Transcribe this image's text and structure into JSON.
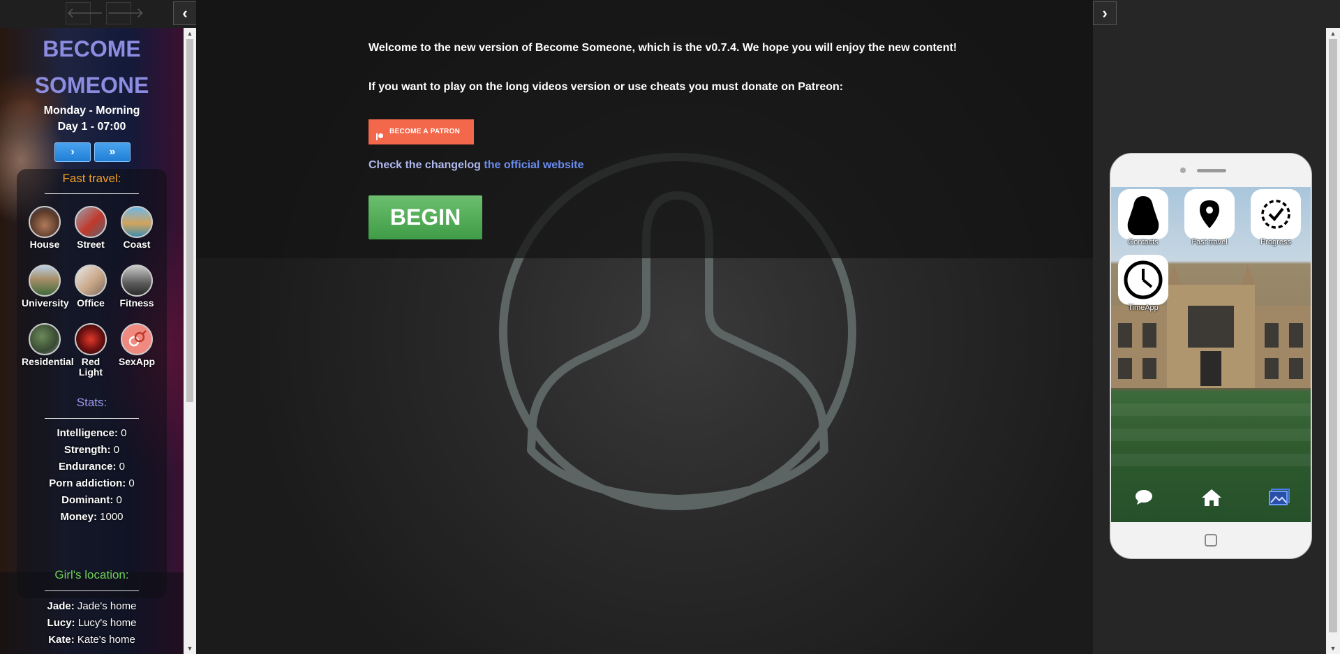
{
  "left_sidebar": {
    "title_line1": "BECOME",
    "title_line2": "SOMEONE",
    "day_time": "Monday - Morning",
    "day_clock": "Day 1 - 07:00",
    "time_buttons": [
      "›",
      "»"
    ],
    "fast_travel_title": "Fast travel:",
    "locations": [
      "House",
      "Street",
      "Coast",
      "University",
      "Office",
      "Fitness",
      "Residential",
      "Red Light",
      "SexApp"
    ],
    "stats_title": "Stats:",
    "stats": [
      {
        "label": "Intelligence:",
        "value": "0"
      },
      {
        "label": "Strength:",
        "value": "0"
      },
      {
        "label": "Endurance:",
        "value": "0"
      },
      {
        "label": "Porn addiction:",
        "value": "0"
      },
      {
        "label": "Dominant:",
        "value": "0"
      },
      {
        "label": "Money:",
        "value": "1000"
      }
    ],
    "girls_title": "Girl's location:",
    "girls": [
      {
        "name": "Jade:",
        "location": "Jade's home"
      },
      {
        "name": "Lucy:",
        "location": "Lucy's home"
      },
      {
        "name": "Kate:",
        "location": "Kate's home"
      }
    ]
  },
  "main": {
    "welcome": "Welcome to the new version of Become Someone, which is the v0.7.4. We hope you will enjoy the new content!",
    "donate": "If you want to play on the long videos version or use cheats you must donate on Patreon:",
    "patron_button": "BECOME A PATRON",
    "changelog_prefix": "Check the changelog ",
    "changelog_link": "the official website",
    "begin_button": "BEGIN"
  },
  "phone": {
    "apps": [
      "Contacts",
      "Fast travel",
      "Progress",
      "TimeApp"
    ]
  },
  "colors": {
    "title": "#8c8ce0",
    "fast_travel": "#f4a024",
    "stats": "#9c9cf0",
    "girls": "#6fd05a",
    "patron": "#f3674a",
    "begin": "#5cb562",
    "link": "#6b8df2"
  }
}
